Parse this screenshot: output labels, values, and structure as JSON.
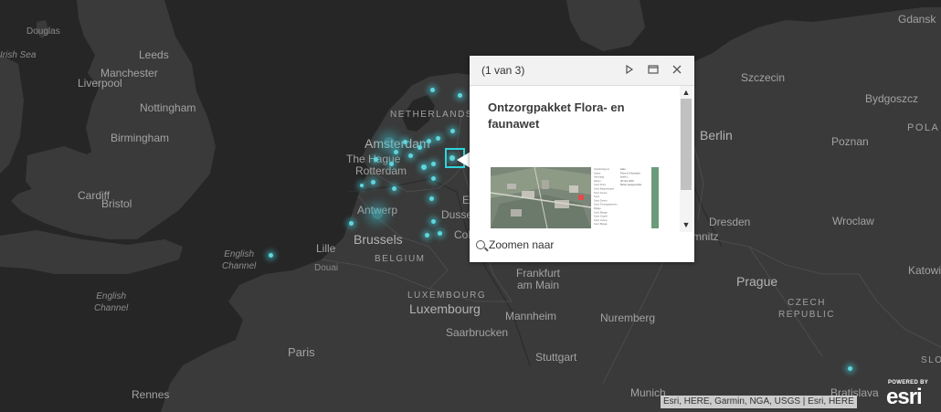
{
  "map": {
    "labels": {
      "douglas": "Douglas",
      "irish_sea": "Irish Sea",
      "leeds": "Leeds",
      "manchester": "Manchester",
      "liverpool": "Liverpool",
      "nottingham": "Nottingham",
      "birmingham": "Birmingham",
      "cardiff": "Cardiff",
      "bristol": "Bristol",
      "english_channel_1": "English\nChannel",
      "english_channel_2": "English\nChannel",
      "paris": "Paris",
      "rennes": "Rennes",
      "lille": "Lille",
      "douai": "Douai",
      "brussels": "Brussels",
      "belgium": "BELGIUM",
      "antwerp": "Antwerp",
      "the_hague": "The Hague",
      "rotterdam": "Rotterdam",
      "amsterdam": "Amsterdam",
      "netherlands": "NETHERLANDS",
      "dusseldorf": "Dusse",
      "cologne": "Colo",
      "essen": "E",
      "luxembourg_country": "LUXEMBOURG",
      "luxembourg_city": "Luxembourg",
      "saarbrucken": "Saarbrucken",
      "mannheim": "Mannheim",
      "frankfurt": "Frankfurt\nam Main",
      "stuttgart": "Stuttgart",
      "nuremberg": "Nuremberg",
      "munich": "Munich",
      "prague": "Prague",
      "czech": "CZECH\nREPUBLIC",
      "dresden": "Dresden",
      "chemnitz": "mnitz",
      "berlin": "Berlin",
      "szczecin": "Szczecin",
      "bydgoszcz": "Bydgoszcz",
      "gdansk": "Gdansk",
      "poland": "POLA",
      "poznan": "Poznan",
      "wroclaw": "Wroclaw",
      "katowice": "Katowi",
      "slovakia": "SLO",
      "bratislava": "Bratislava"
    },
    "colors": {
      "land": "#3a3a3a",
      "water": "#262626",
      "points": "#5fd6dc"
    }
  },
  "popup": {
    "count": "(1 van 3)",
    "title": "Ontzorgpakket Flora- en faunawet",
    "zoom_label": "Zoomen naar",
    "form_rows": [
      [
        "Opdrachtgever",
        "Fake"
      ],
      [
        "Status",
        "Flora en Faunawet"
      ],
      [
        "Aanvraag",
        "lonen 1"
      ],
      [
        "Datum",
        "30 Nov 2015"
      ],
      [
        "Soort Flora",
        "Buiten aangemerkte"
      ],
      [
        "Soort Begroeiingen",
        ""
      ],
      [
        "Soort Fauna",
        ""
      ],
      [
        "Soort",
        ""
      ],
      [
        "Soort Dieren",
        ""
      ],
      [
        "Soort Faunagegevens",
        ""
      ],
      [
        "Bijlage",
        ""
      ],
      [
        "Soort Bijlage",
        ""
      ],
      [
        "Soort Vogels",
        ""
      ],
      [
        "Soort Overig",
        ""
      ],
      [
        "Soort Bijlage",
        ""
      ]
    ]
  },
  "attribution": "Esri, HERE, Garmin, NGA, USGS | Esri, HERE",
  "esri": {
    "powered_by": "POWERED BY",
    "logo": "esri"
  }
}
